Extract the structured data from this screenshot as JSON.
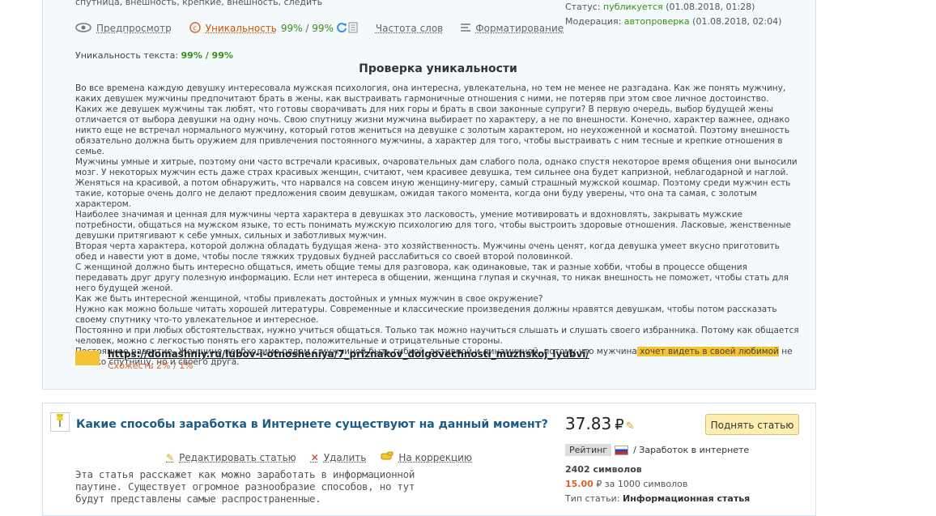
{
  "article1": {
    "tags_text": "спутница, внешность, крепкие, внешность, следить",
    "status_label": "Статус:",
    "status_value": "публикуется",
    "status_time": "(01.08.2018, 01:28)",
    "moderation_label": "Модерация:",
    "moderation_value": "автопроверка",
    "moderation_time": "(01.08.2018, 02:04)",
    "toolbar": {
      "preview": "Предпросмотр",
      "uniqueness": "Уникальность",
      "uniq_value1": "99%",
      "uniq_sep": " / ",
      "uniq_value2": "99%",
      "frequency": "Частота слов",
      "formatting": "Форматирование"
    },
    "uniq_line_label": "Уникальность текста:",
    "uniq_line_value": "99% / 99%",
    "check_title": "Проверка уникальности",
    "paragraphs": [
      "Во все времена каждую девушку интересовала мужская психология, она интересна, увлекательна, но тем не менее не разгадана. Как же понять мужчину, каких девушек мужчины предпочитают брать в жены, как выстраивать гармоничные отношения с ними, не потеряв при этом свое личное достоинство.",
      "Каких же девушек мужчины так любят, что готовы сворачивать для них горы и брать в свои законные супруги? В первую очередь, выбор будущей жены отличается от выбора девушки на одну ночь. Свою спутницу жизни мужчина выбирает по характеру, а не по внешности. Конечно, характер важнее, однако никто еще не встречал нормального мужчину, который готов жениться на девушке с золотым характером, но неухоженной и косматой. Поэтому внешность обязательно должна быть оружием для привлечения постоянного мужчины, а характер для того, чтобы выстраивать с ним тесные и крепкие отношения в семье.",
      "Мужчины умные и хитрые, поэтому они часто встречали красивых, очаровательных дам слабого пола, однако спустя некоторое время общения они выносили мозг. У некоторых мужчин есть даже страх красивых женщин, считают, чем красивее девушка, тем сильнее она будет капризной, неблагодарной и наглой. Женяться на красивой, а потом обнаружить, что нарвался на совсем иную женщину-мигеру, самый страшный мужской кошмар. Поэтому среди мужчин есть такие, которые очень долго не делают предложения своим девушкам, ожидая такого момента, когда они буду уверены, что она та самая, с золотым характером.",
      "Наиболее значимая и ценная для мужчины черта характера в девушках это ласковость, умение мотивировать и вдохновлять, закрывать мужские потребности, общаться на мужском языке, то есть понимать мужскую психологию для того, чтобы выстроить здоровые отношения. Ласковые, женственные девушки притягивают к себе умных, сильных и заботливых мужчин.",
      "Вторая черта характера, которой должна обладать будущая жена- это хозяйственность. Мужчины очень ценят, когда девушка умеет вкусно приготовить обед и навести уют в доме, чтобы после тяжких трудовых будней расслабиться со своей второй половинкой.",
      "С женщиной должно быть интересно общаться, иметь общие темы для разговора, как одинаковые, так и разные хобби, чтобы в процессе общения передавать друг другу полезную информацию. Если нет интереса в общении, женщина глупая и скучная, то никак внешность не поможет, чтобы стать для него будущей женой.",
      "Как же быть интересной женщиной, чтобы привлекать достойных и умных мужчин в свое окружение?",
      "Нужно как можно больше читать хорошей литературы. Современные и классические произведения должны нравятся девушкам, чтобы потом рассказать своему спутнику что-то увлекательное и интересное.",
      "Постоянно и при любых обстоятельствах, нужно учиться общаться. Только так можно научиться слышать и слушать своего избранника. Потому как общается человек, можно с легкостью понять его характер, положительные и отрицательные стороны."
    ],
    "last_para_before": "Постоянное развитие. Женщине необходимо рядом с мужчиной быть гибкой, активной и динамичной, потому что мужчина",
    "last_para_highlight": " хочет видеть в своей любимой",
    "last_para_after": " не только спутницу, но и своего друга.",
    "source_url": "https://domashniy.ru/lubov-i-otnosheniya/7_priznakov_dolgovechnosti_muzhskoj_lyubvi/",
    "source_similarity": "Схожесть 2% / 1%"
  },
  "article2": {
    "title": "Какие способы заработка в Интернете существуют на данный момент?",
    "price": "37.83",
    "currency": "₽",
    "raise_button": "Поднять статью",
    "edit": "Редактировать статью",
    "delete": "Удалить",
    "correction": "На коррекцию",
    "rating_label": "Рейтинг",
    "category": "/ Заработок в интернете",
    "chars": "2402 символов",
    "rate_value": "15.00",
    "rate_suffix": "₽ за 1000 символов",
    "type_label": "Тип статьи:",
    "type_value": "Информационная статья",
    "description": "Эта статья расскажет как можно заработать в информационной паутине. Существует огромное разнообразие способов, но тут будут представлены самые распространенные."
  },
  "colors": {
    "link_blue": "#1a5b87",
    "green": "#3a8f1c",
    "orange": "#e0602b",
    "highlight": "#f4c430"
  }
}
